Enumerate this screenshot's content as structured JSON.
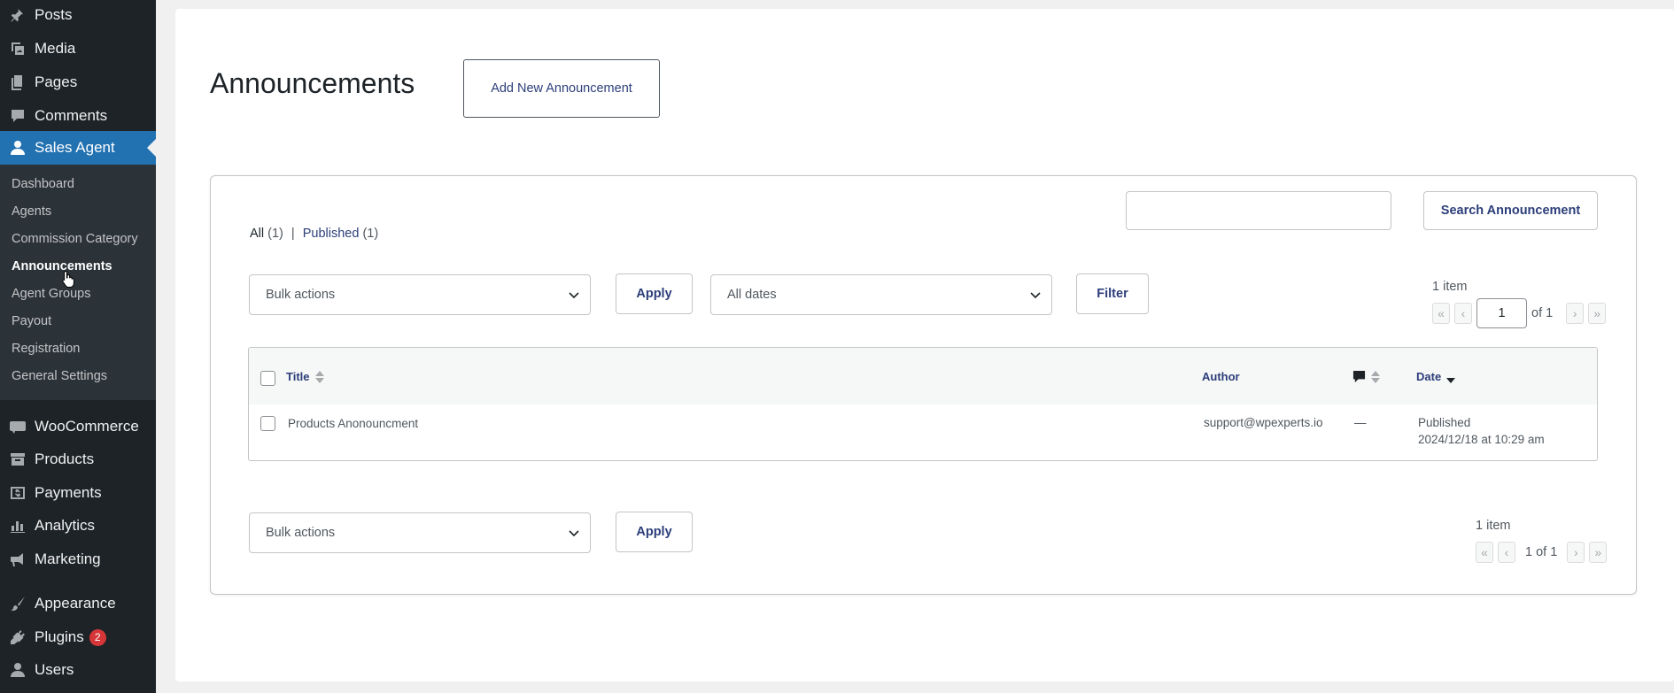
{
  "sidebar": {
    "items": [
      {
        "label": "Posts",
        "icon": "pin-icon"
      },
      {
        "label": "Media",
        "icon": "media-icon"
      },
      {
        "label": "Pages",
        "icon": "pages-icon"
      },
      {
        "label": "Comments",
        "icon": "comment-icon"
      },
      {
        "label": "Sales Agent",
        "icon": "user-icon"
      },
      {
        "label": "WooCommerce",
        "icon": "woo-icon"
      },
      {
        "label": "Products",
        "icon": "archive-icon"
      },
      {
        "label": "Payments",
        "icon": "dollar-icon"
      },
      {
        "label": "Analytics",
        "icon": "bar-chart-icon"
      },
      {
        "label": "Marketing",
        "icon": "megaphone-icon"
      },
      {
        "label": "Appearance",
        "icon": "brush-icon"
      },
      {
        "label": "Plugins",
        "icon": "plug-icon"
      },
      {
        "label": "Users",
        "icon": "users-icon"
      }
    ],
    "submenu": [
      "Dashboard",
      "Agents",
      "Commission Category",
      "Announcements",
      "Agent Groups",
      "Payout",
      "Registration",
      "General Settings"
    ],
    "plugins_badge": "2"
  },
  "page": {
    "title": "Announcements",
    "add_new": "Add New Announcement"
  },
  "views": {
    "all_label": "All",
    "all_count": "(1)",
    "separator": "|",
    "published_label": "Published",
    "published_count": "(1)"
  },
  "search": {
    "button": "Search Announcement",
    "value": ""
  },
  "top_nav": {
    "bulk_actions": "Bulk actions",
    "apply": "Apply",
    "dates": "All dates",
    "filter": "Filter",
    "items_count": "1 item",
    "first": "«",
    "prev": "‹",
    "next": "›",
    "last": "»",
    "current_page": "1",
    "of_pages": "of 1"
  },
  "table": {
    "headers": {
      "title": "Title",
      "author": "Author",
      "date": "Date"
    },
    "rows": [
      {
        "title": "Products Anonouncment",
        "author": "support@wpexperts.io",
        "comments": "—",
        "status": "Published",
        "date": "2024/12/18 at 10:29 am"
      }
    ]
  },
  "bottom_nav": {
    "bulk_actions": "Bulk actions",
    "apply": "Apply",
    "items_count": "1 item",
    "page_text": "1 of 1"
  }
}
